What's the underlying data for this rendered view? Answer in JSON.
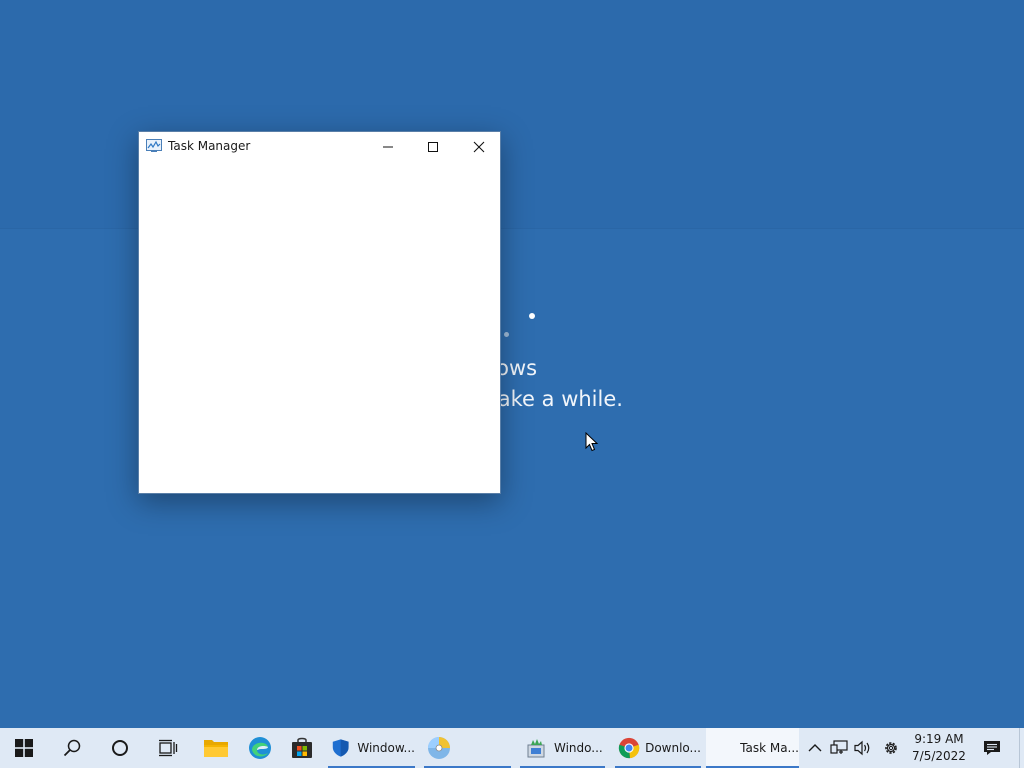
{
  "setup": {
    "line1": "ng Windows",
    "line2": "uter. This may take a while."
  },
  "window": {
    "title": "Task Manager",
    "icon": "task-manager-icon"
  },
  "taskbar": {
    "pinned": [
      {
        "name": "start-icon"
      },
      {
        "name": "search-icon"
      },
      {
        "name": "cortana-icon"
      },
      {
        "name": "task-view-icon"
      },
      {
        "name": "file-explorer-icon"
      },
      {
        "name": "edge-icon"
      },
      {
        "name": "store-icon"
      }
    ],
    "apps": [
      {
        "label": "Window...",
        "icon": "windows-security-icon"
      },
      {
        "label": "",
        "icon": "media-disc-icon"
      },
      {
        "label": "Windo...",
        "icon": "windows-setup-icon"
      },
      {
        "label": "Downlo...",
        "icon": "chrome-icon"
      },
      {
        "label": "Task Ma...",
        "icon": "task-manager-icon"
      }
    ],
    "tray": {
      "time": "9:19 AM",
      "date": "7/5/2022"
    }
  },
  "colors": {
    "desktop": "#2e6daf",
    "taskbar": "#dfe9f5",
    "accent": "#3b78c8"
  }
}
